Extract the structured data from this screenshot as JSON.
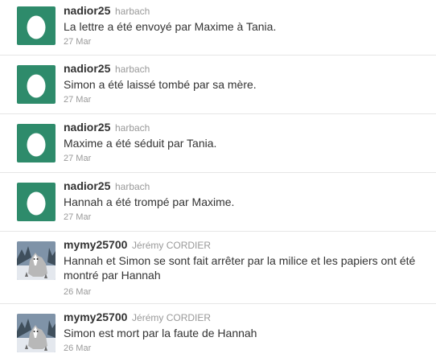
{
  "colors": {
    "egg_bg": "#2e8b6b",
    "name_text": "#333333",
    "meta_text": "#999999",
    "divider": "#e6e6e6"
  },
  "tweets": [
    {
      "avatar_icon": "default-egg-avatar-icon",
      "username": "nadior25",
      "fullname": "harbach",
      "text": "La lettre a été envoyé par Maxime à Tania.",
      "time": "27 Mar"
    },
    {
      "avatar_icon": "default-egg-avatar-icon",
      "username": "nadior25",
      "fullname": "harbach",
      "text": "Simon a été laissé tombé par sa mère.",
      "time": "27 Mar"
    },
    {
      "avatar_icon": "default-egg-avatar-icon",
      "username": "nadior25",
      "fullname": "harbach",
      "text": "Maxime a été séduit par Tania.",
      "time": "27 Mar"
    },
    {
      "avatar_icon": "default-egg-avatar-icon",
      "username": "nadior25",
      "fullname": "harbach",
      "text": "Hannah a été trompé par Maxime.",
      "time": "27 Mar"
    },
    {
      "avatar_icon": "wolf-photo-avatar-icon",
      "username": "mymy25700",
      "fullname": "Jérémy CORDIER",
      "text": "Hannah et Simon se sont fait arrêter par la milice et les papiers ont été montré par Hannah",
      "time": "26 Mar"
    },
    {
      "avatar_icon": "wolf-photo-avatar-icon",
      "username": "mymy25700",
      "fullname": "Jérémy CORDIER",
      "text": "Simon est mort par la faute de Hannah",
      "time": "26 Mar"
    }
  ]
}
